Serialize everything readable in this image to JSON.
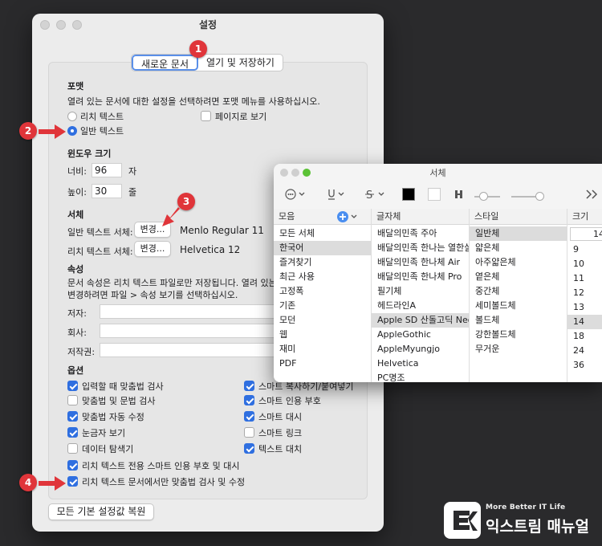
{
  "prefs": {
    "title": "설정",
    "tabs": [
      "새로운 문서",
      "열기 및 저장하기"
    ],
    "format": {
      "heading": "포맷",
      "desc": "열려 있는 문서에 대한 설정을 선택하려면 포맷 메뉴를 사용하십시오.",
      "rich_text": "리치 텍스트",
      "plain_text": "일반 텍스트",
      "wrap_page": "페이지로 보기"
    },
    "window_size": {
      "heading": "윈도우 크기",
      "width_label": "너비:",
      "width_value": "96",
      "width_unit": "자",
      "height_label": "높이:",
      "height_value": "30",
      "height_unit": "줄"
    },
    "font": {
      "heading": "서체",
      "plain_label": "일반 텍스트 서체:",
      "rich_label": "리치 텍스트 서체:",
      "change_button": "변경...",
      "plain_font": "Menlo Regular 11",
      "rich_font": "Helvetica 12"
    },
    "properties": {
      "heading": "속성",
      "desc1": "문서 속성은 리치 텍스트 파일로만 저장됩니다. 열려 있는 문",
      "desc2": "변경하려면 파일 > 속성 보기를 선택하십시오.",
      "author": "저자:",
      "company": "회사:",
      "copyright": "저작권:"
    },
    "options": {
      "heading": "옵션",
      "left": [
        {
          "label": "입력할 때 맞춤법 검사",
          "checked": true
        },
        {
          "label": "맞춤법 및 문법 검사",
          "checked": false
        },
        {
          "label": "맞춤법 자동 수정",
          "checked": true
        },
        {
          "label": "눈금자 보기",
          "checked": true
        },
        {
          "label": "데이터 탐색기",
          "checked": false
        }
      ],
      "right": [
        {
          "label": "스마트 복사하기/붙여넣기",
          "checked": true
        },
        {
          "label": "스마트 인용 부호",
          "checked": true
        },
        {
          "label": "스마트 대시",
          "checked": true
        },
        {
          "label": "스마트 링크",
          "checked": false
        },
        {
          "label": "텍스트 대치",
          "checked": true
        }
      ],
      "rich_quotes": "리치 텍스트 전용 스마트 인용 부호 및 대시",
      "rich_spell": "리치 텍스트 문서에서만 맞춤법 검사 및 수정"
    },
    "restore_button": "모든 기본 설정값 복원"
  },
  "badges": [
    "1",
    "2",
    "3",
    "4"
  ],
  "fonts_panel": {
    "title": "서체",
    "collections_header": "모음",
    "family_header": "글자체",
    "style_header": "스타일",
    "size_header": "크기",
    "size_value": "14",
    "collections": [
      "모든 서체",
      "한국어",
      "즐겨찾기",
      "최근 사용",
      "고정폭",
      "기존",
      "모던",
      "웹",
      "재미",
      "PDF"
    ],
    "families": [
      "배달의민족 주아",
      "배달의민족 한나는 열한살",
      "배달의민족 한나체 Air",
      "배달의민족 한나체 Pro",
      "필기체",
      "헤드라인A",
      "Apple SD 산돌고딕 Neo",
      "AppleGothic",
      "AppleMyungjo",
      "Helvetica",
      "PC명조"
    ],
    "styles": [
      "일반체",
      "얇은체",
      "아주얇은체",
      "옅은체",
      "중간체",
      "세미볼드체",
      "볼드체",
      "강한볼드체",
      "무거운"
    ],
    "sizes": [
      "9",
      "10",
      "11",
      "12",
      "13",
      "14",
      "18",
      "24",
      "36"
    ],
    "selected_collection": "한국어",
    "selected_family": "Apple SD 산돌고딕 Neo",
    "selected_style": "일반체",
    "selected_size": "14",
    "colors": {
      "text": "#000000",
      "doc": "#ffffff"
    }
  },
  "watermark": {
    "tagline": "More Better IT Life",
    "brand": "익스트림 매뉴얼"
  }
}
